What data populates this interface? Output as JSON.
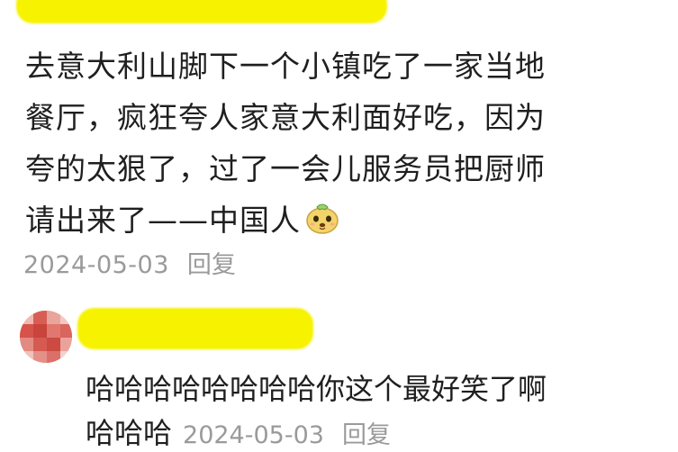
{
  "main_comment": {
    "lines": [
      "去意大利山脚下一个小镇吃了一家当地",
      "餐厅，疯狂夸人家意大利面好吃，因为",
      "夸的太狠了，过了一会儿服务员把厨师",
      "请出来了——中国人"
    ],
    "emoji": "dog-face-emoji",
    "date": "2024-05-03",
    "reply_label": "回复"
  },
  "sub_reply": {
    "text": "哈哈哈哈哈哈哈哈你这个最好笑了啊",
    "text_continued": "哈哈哈",
    "date": "2024-05-03",
    "reply_label": "回复"
  },
  "colors": {
    "redaction": "#f6f200",
    "meta_text": "#9a9a9a",
    "body_text": "#1f1f1f"
  }
}
